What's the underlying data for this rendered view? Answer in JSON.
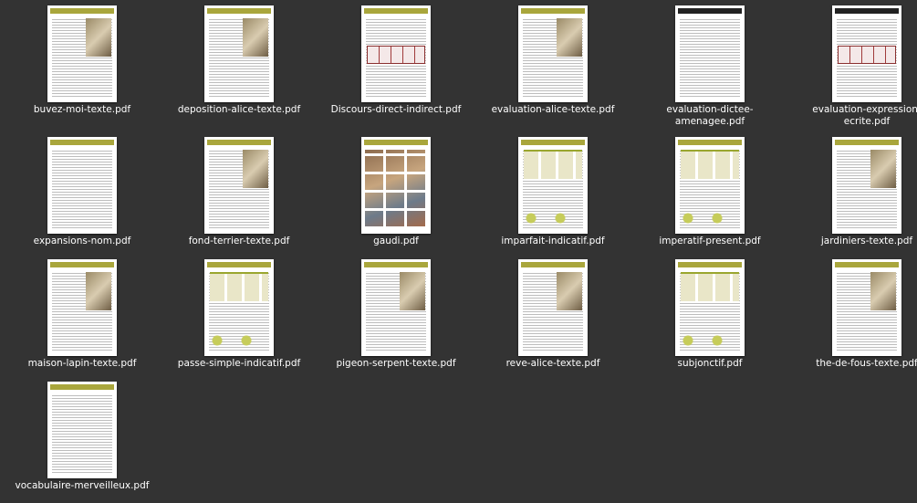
{
  "accent_colors": {
    "olive": "#a9a63c",
    "red": "#8e2f2f",
    "dark": "#222222"
  },
  "files": [
    {
      "name": "buvez-moi-texte.pdf",
      "kind": "text-image"
    },
    {
      "name": "deposition-alice-texte.pdf",
      "kind": "text-image"
    },
    {
      "name": "Discours-direct-indirect.pdf",
      "kind": "table-red"
    },
    {
      "name": "evaluation-alice-texte.pdf",
      "kind": "text-image"
    },
    {
      "name": "evaluation-dictee-amenagee.pdf",
      "kind": "text-dark"
    },
    {
      "name": "evaluation-expression-ecrite.pdf",
      "kind": "table-red-dark"
    },
    {
      "name": "expansions-nom.pdf",
      "kind": "text"
    },
    {
      "name": "fond-terrier-texte.pdf",
      "kind": "text-image"
    },
    {
      "name": "gaudi.pdf",
      "kind": "photos"
    },
    {
      "name": "imparfait-indicatif.pdf",
      "kind": "grammar"
    },
    {
      "name": "imperatif-present.pdf",
      "kind": "grammar"
    },
    {
      "name": "jardiniers-texte.pdf",
      "kind": "text-image"
    },
    {
      "name": "maison-lapin-texte.pdf",
      "kind": "text-image"
    },
    {
      "name": "passe-simple-indicatif.pdf",
      "kind": "grammar"
    },
    {
      "name": "pigeon-serpent-texte.pdf",
      "kind": "text-image"
    },
    {
      "name": "reve-alice-texte.pdf",
      "kind": "text-image"
    },
    {
      "name": "subjonctif.pdf",
      "kind": "grammar"
    },
    {
      "name": "the-de-fous-texte.pdf",
      "kind": "text-image"
    },
    {
      "name": "vocabulaire-merveilleux.pdf",
      "kind": "text"
    }
  ],
  "label_lines": {
    "4": [
      "evaluation-dictee-",
      "amenagee.pdf"
    ],
    "5": [
      "evaluation-expression-",
      "ecrite.pdf"
    ]
  }
}
